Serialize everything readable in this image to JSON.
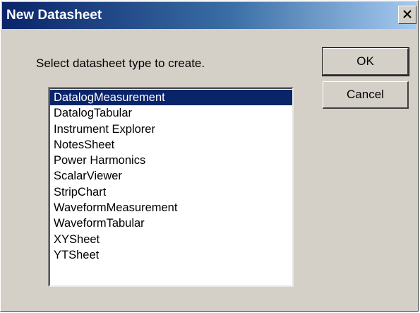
{
  "window": {
    "title": "New Datasheet",
    "close_icon": "close-icon"
  },
  "dialog": {
    "prompt": "Select datasheet type to create."
  },
  "buttons": {
    "ok_label": "OK",
    "cancel_label": "Cancel"
  },
  "datasheet_types": {
    "items": [
      "DatalogMeasurement",
      "DatalogTabular",
      "Instrument Explorer",
      "NotesSheet",
      "Power Harmonics",
      "ScalarViewer",
      "StripChart",
      "WaveformMeasurement",
      "WaveformTabular",
      "XYSheet",
      "YTSheet"
    ],
    "selected": "DatalogMeasurement"
  },
  "colors": {
    "title_bar_start": "#0a246a",
    "title_bar_end": "#a6caf0",
    "face": "#d4d0c8",
    "selection": "#0a246a"
  }
}
